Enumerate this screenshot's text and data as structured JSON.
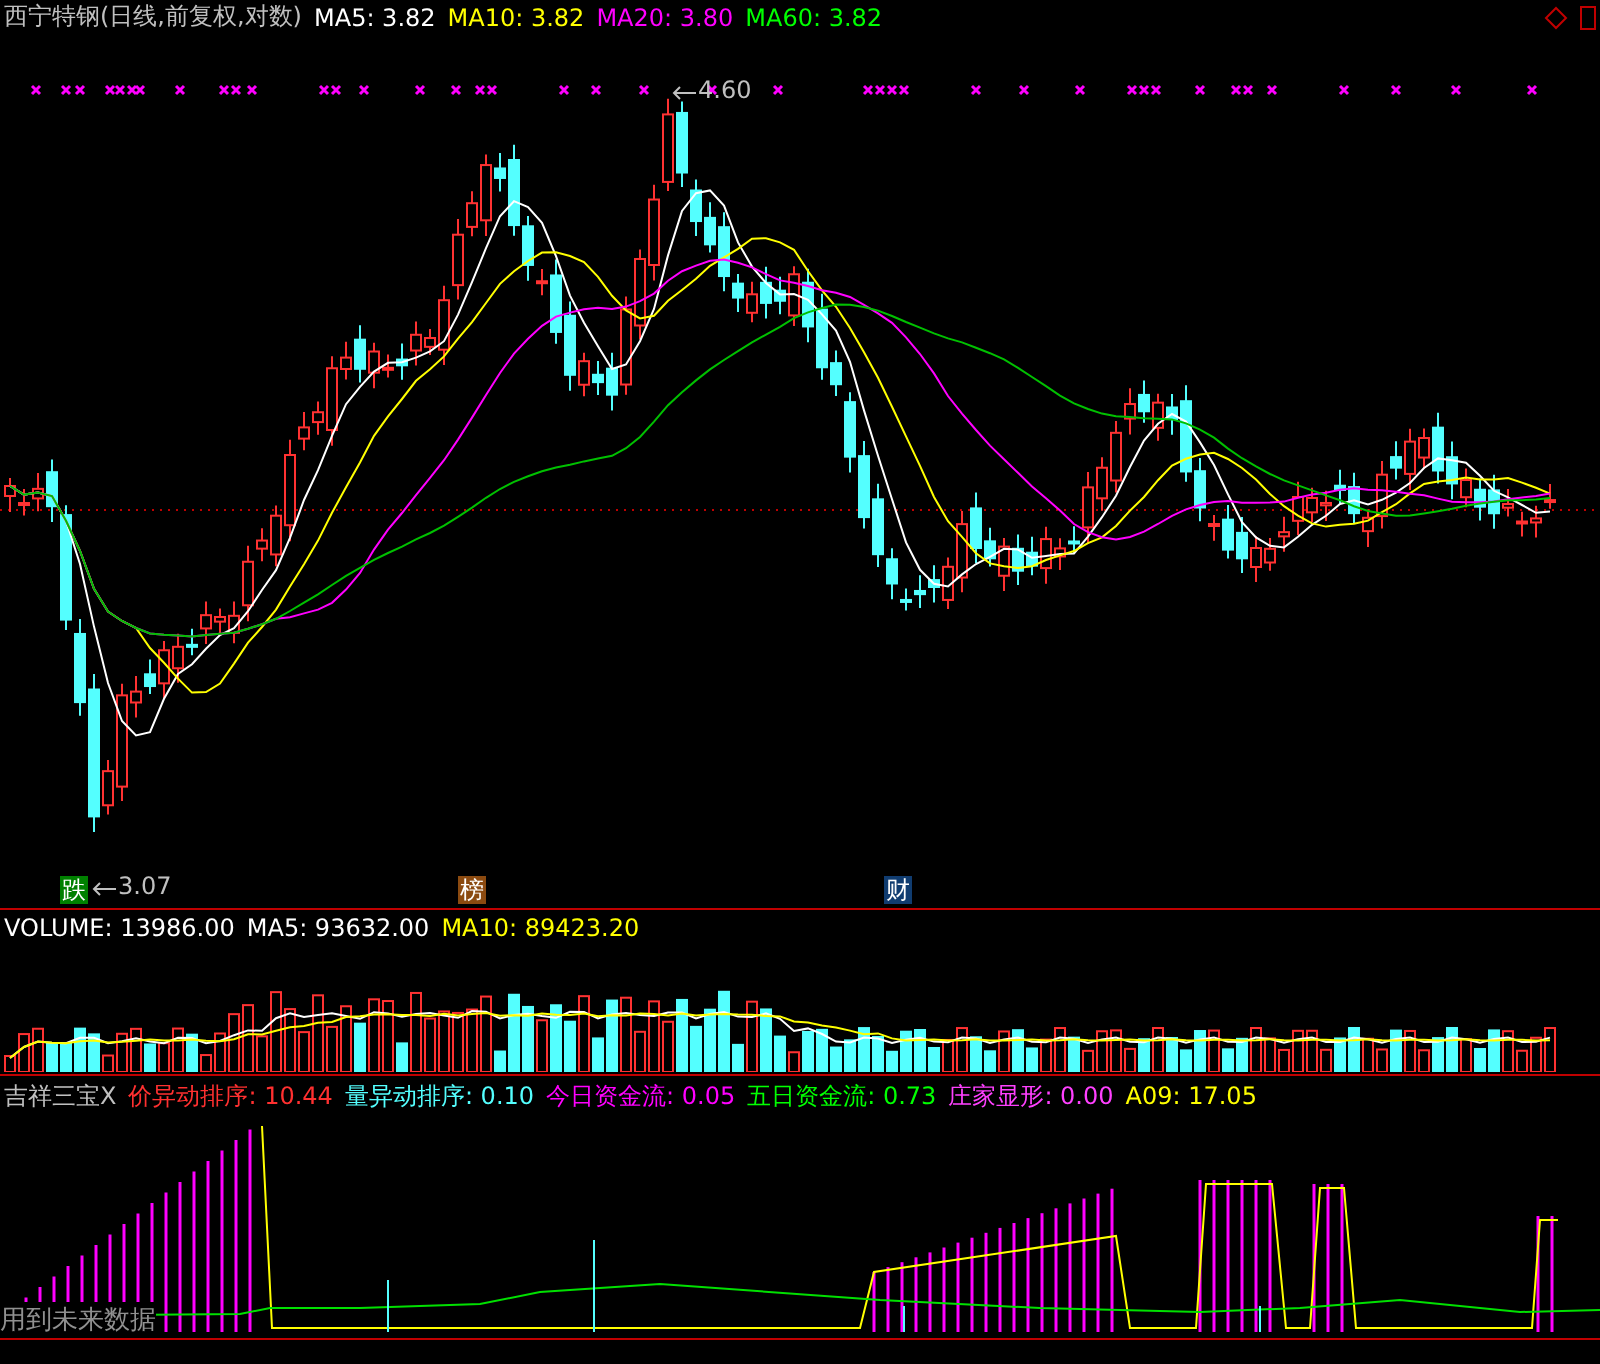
{
  "header": {
    "title": "西宁特钢(日线,前复权,对数)",
    "averages": [
      {
        "label": "MA5: 3.82",
        "color": "#ffffff"
      },
      {
        "label": "MA10: 3.82",
        "color": "#ffff00"
      },
      {
        "label": "MA20: 3.80",
        "color": "#ff00ff"
      },
      {
        "label": "MA60: 3.82",
        "color": "#00ff00"
      }
    ]
  },
  "main": {
    "high_label": "4.60",
    "low_label": "3.07",
    "markers": [
      {
        "text": "跌",
        "color": "#008000"
      },
      {
        "text": "榜",
        "color": "#8b4a10"
      },
      {
        "text": "财",
        "color": "#103c70"
      }
    ]
  },
  "volume": {
    "items": [
      {
        "label": "VOLUME: 13986.00",
        "color": "#ffffff"
      },
      {
        "label": "MA5: 93632.00",
        "color": "#ffffff"
      },
      {
        "label": "MA10: 89423.20",
        "color": "#ffff00"
      }
    ]
  },
  "indicator": {
    "title": "吉祥三宝X",
    "items": [
      {
        "label": "价异动排序: 10.44",
        "color": "#ff3030"
      },
      {
        "label": "量异动排序: 0.10",
        "color": "#54ffff"
      },
      {
        "label": "今日资金流: 0.05",
        "color": "#ff00ff"
      },
      {
        "label": "五日资金流: 0.73",
        "color": "#00ff00"
      },
      {
        "label": "庄家显形: 0.00",
        "color": "#ff40ff"
      },
      {
        "label": "A09: 17.05",
        "color": "#ffff00"
      }
    ],
    "warning": "用到未来数据"
  }
}
